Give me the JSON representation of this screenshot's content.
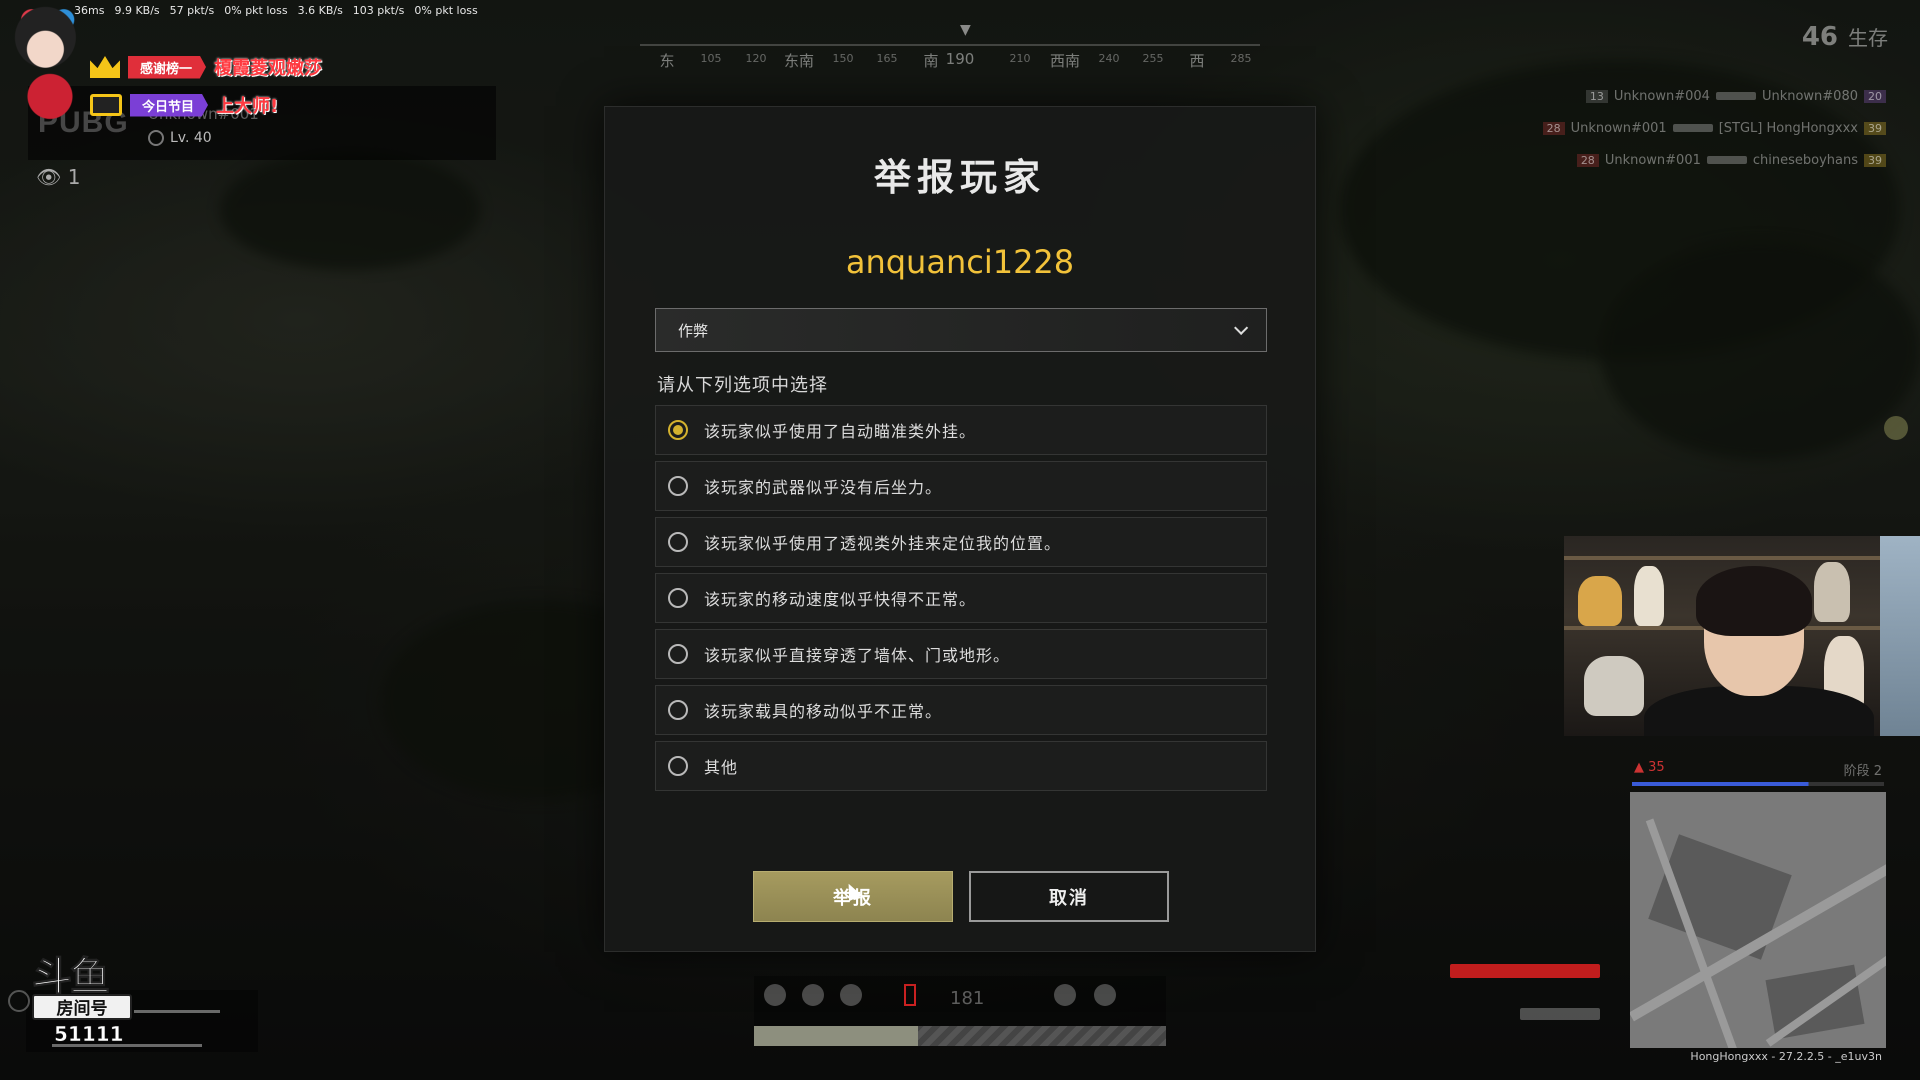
{
  "netstats": [
    "36ms",
    "9.9 KB/s",
    "57 pkt/s",
    "0% pkt loss",
    "3.6 KB/s",
    "103 pkt/s",
    "0% pkt loss"
  ],
  "overlay": {
    "thanks_label": "感谢榜一",
    "thanks_value": "榎霞菱观嫩莎",
    "program_label": "今日节目",
    "program_value": "上大师!"
  },
  "spectate": {
    "logo": "PUBG",
    "player_name": "Unknown#001",
    "level": "Lv. 40",
    "spectator_count": "1"
  },
  "compass": {
    "labels": [
      "东",
      "105",
      "120",
      "东南",
      "150",
      "165",
      "南",
      "190",
      "210",
      "西南",
      "240",
      "255",
      "西",
      "285"
    ]
  },
  "alive": {
    "count": "46",
    "label": "生存"
  },
  "killfeed": [
    {
      "num_left": "13",
      "killer": "Unknown#004",
      "victim": "Unknown#080",
      "num_right": "20"
    },
    {
      "num_left": "28",
      "killer": "Unknown#001",
      "victim": "[STGL] HongHongxxx",
      "num_right": "39"
    },
    {
      "num_left": "28",
      "killer": "Unknown#001",
      "victim": "chineseboyhans",
      "num_right": "39"
    }
  ],
  "modal": {
    "title": "举报玩家",
    "player": "anquanci1228",
    "category": "作弊",
    "prompt": "请从下列选项中选择",
    "options": [
      "该玩家似乎使用了自动瞄准类外挂。",
      "该玩家的武器似乎没有后坐力。",
      "该玩家似乎使用了透视类外挂来定位我的位置。",
      "该玩家的移动速度似乎快得不正常。",
      "该玩家似乎直接穿透了墙体、门或地形。",
      "该玩家载具的移动似乎不正常。",
      "其他"
    ],
    "selected_index": 0,
    "report_button": "举报",
    "cancel_button": "取消"
  },
  "minimap": {
    "teammates": "35",
    "phase": "阶段 2"
  },
  "streamer_id": "HongHongxxx - 27.2.2.5 - _e1uv3n",
  "douyu": {
    "logo": "斗鱼",
    "room_label": "房间号",
    "room_number": "51111"
  },
  "hud": {
    "ammo": "181"
  },
  "colors": {
    "accent_gold": "#f2c23a",
    "radio_selected": "#d4b22e",
    "report_button": "#a69b5f"
  }
}
